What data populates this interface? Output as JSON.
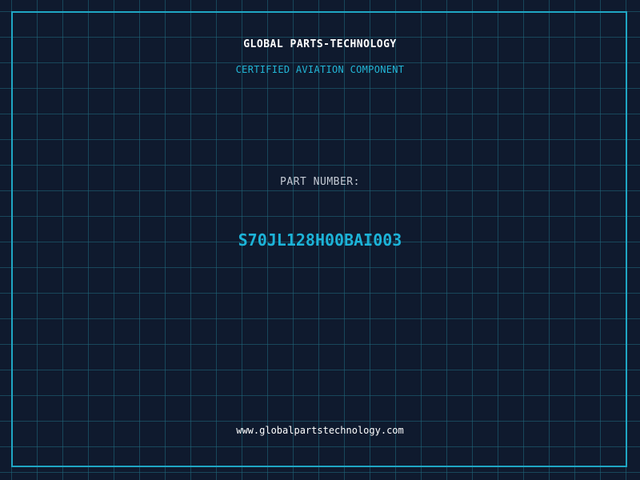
{
  "label": {
    "company": "GLOBAL PARTS-TECHNOLOGY",
    "subtitle": "CERTIFIED AVIATION COMPONENT",
    "part_number_label": "PART NUMBER:",
    "part_number": "S70JL128H00BAI003",
    "website": "www.globalpartstechnology.com"
  },
  "colors": {
    "background": "#0f1a2e",
    "grid": "#20697d",
    "border": "#1fa6c4",
    "accent": "#1cb3d8",
    "text_primary": "#ffffff",
    "text_muted": "#c4cad4"
  }
}
